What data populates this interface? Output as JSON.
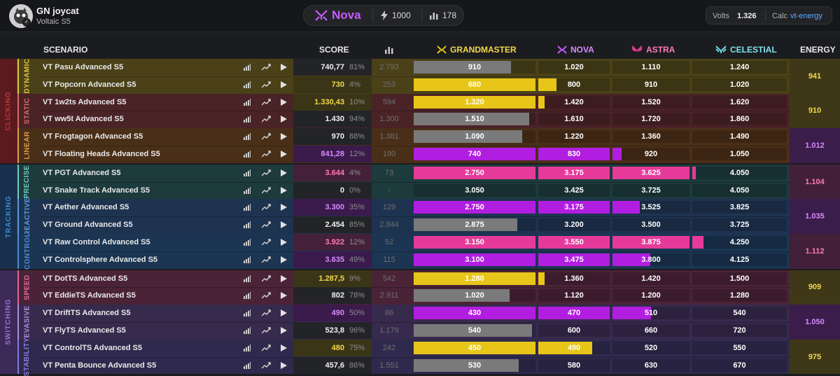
{
  "header": {
    "user_name": "GN joycat",
    "user_sub": "Voltaic S5",
    "rank_name": "Nova",
    "energy_total": "1000",
    "stat_count": "178",
    "volts_label": "Volts",
    "volts_value": "1.326",
    "calc_label": "Calc",
    "calc_value": "vt-energy"
  },
  "columns": {
    "scenario": "SCENARIO",
    "score": "SCORE",
    "grandmaster": "GRANDMASTER",
    "nova": "NOVA",
    "astra": "ASTRA",
    "celestial": "CELESTIAL",
    "energy": "ENERGY"
  },
  "colors": {
    "grandmaster": "#e8c619",
    "nova": "#b21ee0",
    "astra": "#e63a9a",
    "celestial": "#6fd6e0",
    "gray": "#7a7a7a"
  },
  "categories": [
    {
      "label": "CLICKING",
      "color": "#c4343f",
      "bg": "#5a1a1e"
    },
    {
      "label": "TRACKING",
      "color": "#3a8ad6",
      "bg": "#18304d"
    },
    {
      "label": "SWITCHING",
      "color": "#9a6fd6",
      "bg": "#3d2a59"
    }
  ],
  "subcategories": [
    {
      "label": "DYNAMIC",
      "color": "#e0c23a",
      "bg": "#4a4118"
    },
    {
      "label": "STATIC",
      "color": "#d86a6a",
      "bg": "#4a2326"
    },
    {
      "label": "LINEAR",
      "color": "#e09a4a",
      "bg": "#4a2f18"
    },
    {
      "label": "PRECISE",
      "color": "#6ec9c2",
      "bg": "#1d3a3c"
    },
    {
      "label": "REACTIVE",
      "color": "#5a9ae0",
      "bg": "#1e3350"
    },
    {
      "label": "CONTROL",
      "color": "#4a8ad6",
      "bg": "#1b3552"
    },
    {
      "label": "SPEED",
      "color": "#e06a9a",
      "bg": "#4a2336"
    },
    {
      "label": "EVASIVE",
      "color": "#b28ae0",
      "bg": "#362a4d"
    },
    {
      "label": "STABILITY",
      "color": "#8a7ae0",
      "bg": "#2f2a4d"
    }
  ],
  "energies": [
    {
      "value": "941",
      "color": "#f2d94a",
      "bg": "#3f3818"
    },
    {
      "value": "910",
      "color": "#f2d94a",
      "bg": "#3f3818"
    },
    {
      "value": "1.012",
      "color": "#d68aff",
      "bg": "#3a1d4a"
    },
    {
      "value": "1.104",
      "color": "#ff7ab8",
      "bg": "#42203a"
    },
    {
      "value": "1.035",
      "color": "#d68aff",
      "bg": "#3a1d4a"
    },
    {
      "value": "1.112",
      "color": "#ff7ab8",
      "bg": "#42203a"
    },
    {
      "value": "909",
      "color": "#f2d94a",
      "bg": "#3f3818"
    },
    {
      "value": "1.050",
      "color": "#d68aff",
      "bg": "#3a1d4a"
    },
    {
      "value": "975",
      "color": "#f2d94a",
      "bg": "#3f3818"
    }
  ],
  "rows": [
    {
      "name": "VT Pasu Advanced S5",
      "score": "740,77",
      "pct": "81%",
      "plays": "2.793",
      "tier": "none",
      "scoreColor": "#f0f0f0",
      "scoreBg": "#232428",
      "thresholds": [
        "910",
        "1.020",
        "1.110",
        "1.240"
      ],
      "fills": [
        0.8,
        0,
        0,
        0
      ],
      "fillColor": "gray"
    },
    {
      "name": "VT Popcorn Advanced S5",
      "score": "730",
      "pct": "4%",
      "plays": "253",
      "tier": "gm",
      "scoreColor": "#f2d94a",
      "scoreBg": "#3a3516",
      "thresholds": [
        "680",
        "800",
        "910",
        "1.020"
      ],
      "fills": [
        1,
        0.25,
        0,
        0
      ],
      "fillColor": "grandmaster"
    },
    {
      "name": "VT 1w2ts Advanced S5",
      "score": "1.330,43",
      "pct": "10%",
      "plays": "594",
      "tier": "gm",
      "scoreColor": "#f2d94a",
      "scoreBg": "#3a3516",
      "thresholds": [
        "1.320",
        "1.420",
        "1.520",
        "1.620"
      ],
      "fills": [
        1,
        0.09,
        0,
        0
      ],
      "fillColor": "grandmaster"
    },
    {
      "name": "VT ww5t Advanced S5",
      "score": "1.430",
      "pct": "94%",
      "plays": "1.300",
      "tier": "none",
      "scoreColor": "#f0f0f0",
      "scoreBg": "#232428",
      "thresholds": [
        "1.510",
        "1.610",
        "1.720",
        "1.860"
      ],
      "fills": [
        0.95,
        0,
        0,
        0
      ],
      "fillColor": "gray"
    },
    {
      "name": "VT Frogtagon Advanced S5",
      "score": "970",
      "pct": "88%",
      "plays": "1.381",
      "tier": "none",
      "scoreColor": "#f0f0f0",
      "scoreBg": "#232428",
      "thresholds": [
        "1.090",
        "1.220",
        "1.360",
        "1.490"
      ],
      "fills": [
        0.89,
        0,
        0,
        0
      ],
      "fillColor": "gray"
    },
    {
      "name": "VT Floating Heads Advanced S5",
      "score": "841,28",
      "pct": "12%",
      "plays": "190",
      "tier": "nova",
      "scoreColor": "#d68aff",
      "scoreBg": "#3b1a4c",
      "thresholds": [
        "740",
        "830",
        "920",
        "1.050"
      ],
      "fills": [
        1,
        1,
        0.12,
        0
      ],
      "fillColor": "nova"
    },
    {
      "name": "VT PGT Advanced S5",
      "score": "3.644",
      "pct": "4%",
      "plays": "73",
      "tier": "astra",
      "scoreColor": "#ff7ab8",
      "scoreBg": "#45203a",
      "thresholds": [
        "2.750",
        "3.175",
        "3.625",
        "4.050"
      ],
      "fills": [
        1,
        1,
        1,
        0.04
      ],
      "fillColor": "astra"
    },
    {
      "name": "VT Snake Track Advanced S5",
      "score": "0",
      "pct": "0%",
      "plays": "-",
      "tier": "none",
      "scoreColor": "#f0f0f0",
      "scoreBg": "#232428",
      "thresholds": [
        "3.050",
        "3.425",
        "3.725",
        "4.050"
      ],
      "fills": [
        0,
        0,
        0,
        0
      ],
      "fillColor": "gray"
    },
    {
      "name": "VT Aether Advanced S5",
      "score": "3.300",
      "pct": "35%",
      "plays": "129",
      "tier": "nova",
      "scoreColor": "#d68aff",
      "scoreBg": "#3b1a4c",
      "thresholds": [
        "2.750",
        "3.175",
        "3.525",
        "3.825"
      ],
      "fills": [
        1,
        1,
        0.35,
        0
      ],
      "fillColor": "nova"
    },
    {
      "name": "VT Ground Advanced S5",
      "score": "2.454",
      "pct": "85%",
      "plays": "2.844",
      "tier": "none",
      "scoreColor": "#f0f0f0",
      "scoreBg": "#232428",
      "thresholds": [
        "2.875",
        "3.200",
        "3.500",
        "3.725"
      ],
      "fills": [
        0.85,
        0,
        0,
        0
      ],
      "fillColor": "gray"
    },
    {
      "name": "VT Raw Control Advanced S5",
      "score": "3.922",
      "pct": "12%",
      "plays": "52",
      "tier": "astra",
      "scoreColor": "#ff7ab8",
      "scoreBg": "#45203a",
      "thresholds": [
        "3.150",
        "3.550",
        "3.875",
        "4.250"
      ],
      "fills": [
        1,
        1,
        1,
        0.12
      ],
      "fillColor": "astra"
    },
    {
      "name": "VT Controlsphere Advanced S5",
      "score": "3.635",
      "pct": "49%",
      "plays": "115",
      "tier": "nova",
      "scoreColor": "#d68aff",
      "scoreBg": "#3b1a4c",
      "thresholds": [
        "3.100",
        "3.475",
        "3.800",
        "4.125"
      ],
      "fills": [
        1,
        1,
        0.49,
        0
      ],
      "fillColor": "nova"
    },
    {
      "name": "VT DotTS Advanced S5",
      "score": "1.287,5",
      "pct": "9%",
      "plays": "542",
      "tier": "gm",
      "scoreColor": "#f2d94a",
      "scoreBg": "#3a3516",
      "thresholds": [
        "1.280",
        "1.360",
        "1.420",
        "1.500"
      ],
      "fills": [
        1,
        0.09,
        0,
        0
      ],
      "fillColor": "grandmaster"
    },
    {
      "name": "VT EddieTS Advanced S5",
      "score": "802",
      "pct": "78%",
      "plays": "2.911",
      "tier": "none",
      "scoreColor": "#f0f0f0",
      "scoreBg": "#232428",
      "thresholds": [
        "1.020",
        "1.120",
        "1.200",
        "1.280"
      ],
      "fills": [
        0.79,
        0,
        0,
        0
      ],
      "fillColor": "gray"
    },
    {
      "name": "VT DriftTS Advanced S5",
      "score": "490",
      "pct": "50%",
      "plays": "86",
      "tier": "nova",
      "scoreColor": "#d68aff",
      "scoreBg": "#3b1a4c",
      "thresholds": [
        "430",
        "470",
        "510",
        "540"
      ],
      "fills": [
        1,
        1,
        0.5,
        0
      ],
      "fillColor": "nova"
    },
    {
      "name": "VT FlyTS Advanced S5",
      "score": "523,8",
      "pct": "96%",
      "plays": "1.179",
      "tier": "none",
      "scoreColor": "#f0f0f0",
      "scoreBg": "#232428",
      "thresholds": [
        "540",
        "600",
        "660",
        "720"
      ],
      "fills": [
        0.97,
        0,
        0,
        0
      ],
      "fillColor": "gray"
    },
    {
      "name": "VT ControlTS Advanced S5",
      "score": "480",
      "pct": "75%",
      "plays": "242",
      "tier": "gm",
      "scoreColor": "#f2d94a",
      "scoreBg": "#3a3516",
      "thresholds": [
        "450",
        "490",
        "520",
        "550"
      ],
      "fills": [
        1,
        0.75,
        0,
        0
      ],
      "fillColor": "grandmaster"
    },
    {
      "name": "VT Penta Bounce Advanced S5",
      "score": "457,6",
      "pct": "86%",
      "plays": "1.551",
      "tier": "none",
      "scoreColor": "#f0f0f0",
      "scoreBg": "#232428",
      "thresholds": [
        "530",
        "580",
        "630",
        "670"
      ],
      "fills": [
        0.86,
        0,
        0,
        0
      ],
      "fillColor": "gray"
    }
  ]
}
